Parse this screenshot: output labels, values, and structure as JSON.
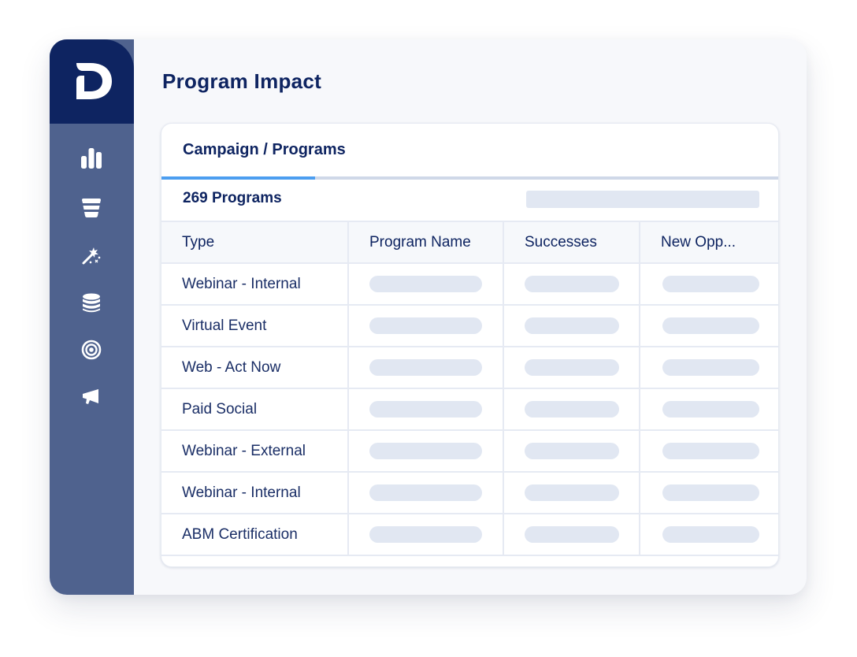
{
  "page": {
    "title": "Program Impact"
  },
  "brand": {
    "logo_letter": "D",
    "primary": "#0e2461",
    "sidebar": "#4f628e",
    "accent": "#4c9ef0"
  },
  "sidebar": {
    "items": [
      {
        "icon": "bar-chart-icon"
      },
      {
        "icon": "funnel-icon"
      },
      {
        "icon": "magic-wand-icon"
      },
      {
        "icon": "database-icon"
      },
      {
        "icon": "target-icon"
      },
      {
        "icon": "megaphone-icon"
      }
    ]
  },
  "card": {
    "tab_label": "Campaign / Programs",
    "count_label": "269 Programs",
    "columns": [
      "Type",
      "Program Name",
      "Successes",
      "New Opp..."
    ],
    "rows": [
      {
        "type": "Webinar - Internal"
      },
      {
        "type": "Virtual Event"
      },
      {
        "type": "Web - Act Now"
      },
      {
        "type": "Paid Social"
      },
      {
        "type": "Webinar - External"
      },
      {
        "type": "Webinar - Internal"
      },
      {
        "type": "ABM Certification"
      }
    ]
  }
}
